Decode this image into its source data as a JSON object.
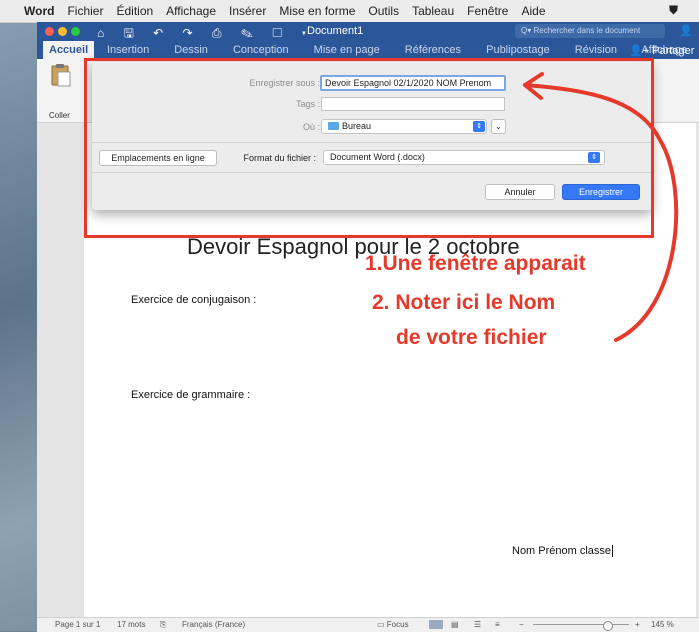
{
  "menubar": {
    "app": "Word",
    "items": [
      "Fichier",
      "Édition",
      "Affichage",
      "Insérer",
      "Mise en forme",
      "Outils",
      "Tableau",
      "Fenêtre",
      "Aide"
    ]
  },
  "window": {
    "title": "Document1",
    "search_placeholder": "Rechercher dans le document",
    "qat": "⌂ 🖫 ↶ ↷ ⎙ ✎ ▢ ▾"
  },
  "ribbon": {
    "active_tab": "Accueil",
    "tabs": [
      "Insertion",
      "Dessin",
      "Conception",
      "Mise en page",
      "Références",
      "Publipostage",
      "Révision",
      "Affichage"
    ],
    "share_label": "Partager",
    "paste_label": "Coller"
  },
  "dialog": {
    "save_as_label": "Enregistrer sous :",
    "save_as_value": "Devoir Espagnol 02/1/2020 NOM Prenom",
    "tags_label": "Tags :",
    "tags_value": "",
    "where_label": "Où :",
    "where_value": "Bureau",
    "online_locations_button": "Emplacements en ligne",
    "format_label": "Format du fichier :",
    "format_value": "Document Word (.docx)",
    "cancel_button": "Annuler",
    "save_button": "Enregistrer"
  },
  "document": {
    "heading": "Devoir Espagnol pour le 2 octobre",
    "exercise1": "Exercice de conjugaison :",
    "exercise2": "Exercice de grammaire :",
    "signature": "Nom Prénom classe"
  },
  "annotations": {
    "line1": "1.Une fenêtre apparait",
    "line2": "2. Noter ici le Nom",
    "line3": "de votre fichier",
    "color": "#e53a2b"
  },
  "statusbar": {
    "page": "Page 1 sur 1",
    "words": "17 mots",
    "language": "Français (France)",
    "focus": "Focus",
    "zoom": "145 %"
  }
}
